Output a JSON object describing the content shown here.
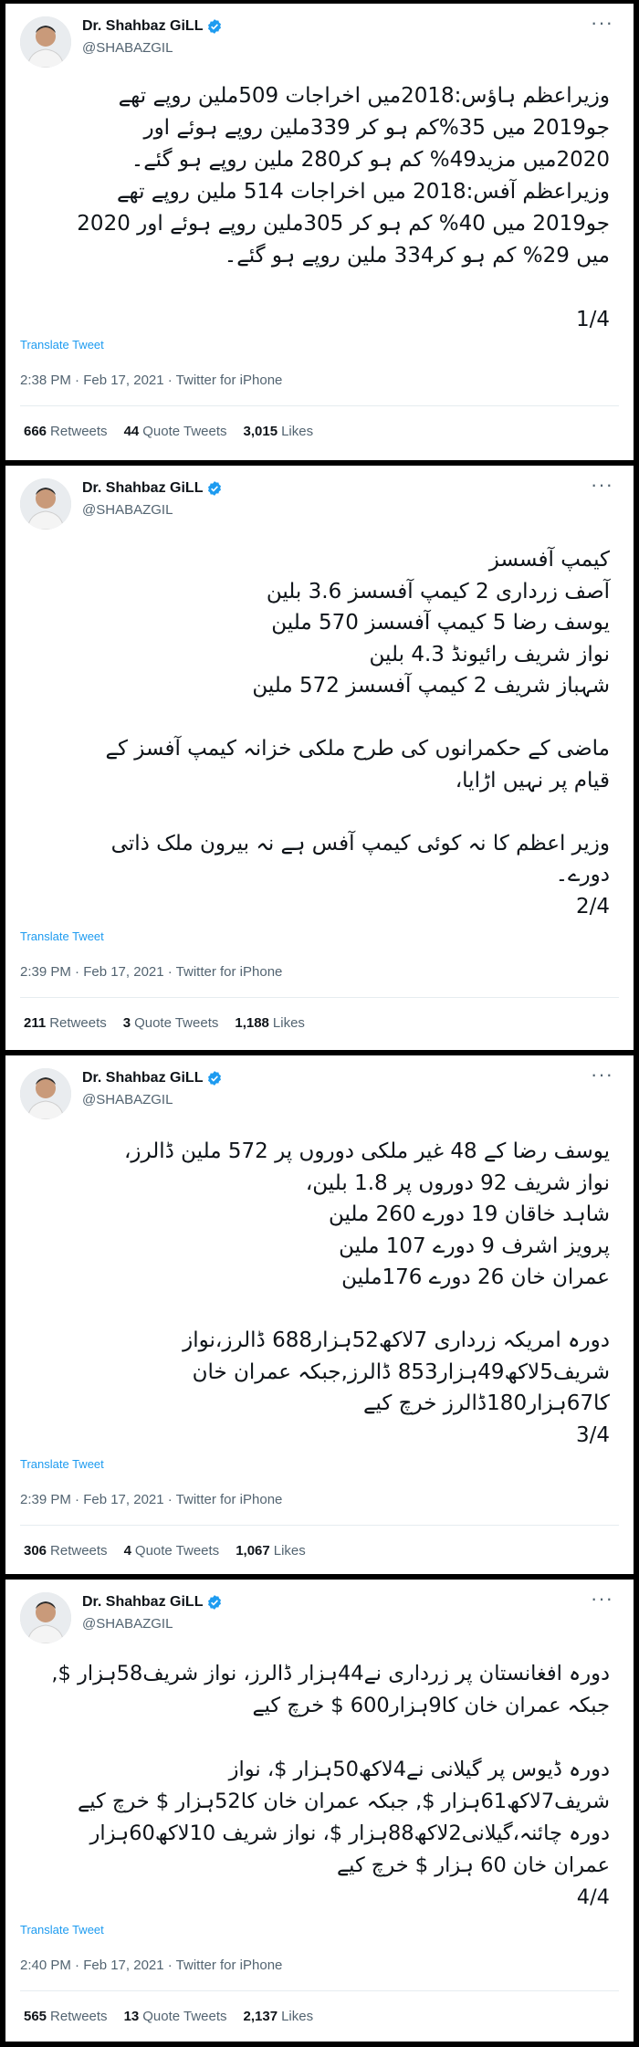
{
  "colors": {
    "link": "#1d9bf0",
    "text": "#0f1419",
    "muted": "#536471",
    "frame": "#000000"
  },
  "tweets": [
    {
      "author": "Dr. Shahbaz GiLL",
      "handle": "@SHABAZGIL",
      "more_icon": "···",
      "text": "وزیراعظم ہاؤس:2018میں اخراجات 509ملین روپے تھے\nجو2019 میں 35%کم ہو کر 339ملین روپے ہوئے اور\n2020میں مزید49% کم ہو کر280 ملین روپے ہو گئے۔\nوزیراعظم آفس:2018 میں اخراجات 514 ملین روپے تھے\nجو2019 میں 40% کم ہو کر 305ملین روپے ہوئے اور 2020\nمیں 29% کم ہو کر334 ملین روپے ہو گئے۔\n\n1/4",
      "translate": "Translate Tweet",
      "timestamp": "2:38 PM · Feb 17, 2021 · Twitter for iPhone",
      "retweets": "666",
      "retweets_label": "Retweets",
      "quotes": "44",
      "quotes_label": "Quote Tweets",
      "likes": "3,015",
      "likes_label": "Likes"
    },
    {
      "author": "Dr. Shahbaz GiLL",
      "handle": "@SHABAZGIL",
      "more_icon": "···",
      "text": "کیمپ آفسسز\nآصف زرداری 2 کیمپ آفسسز 3.6 بلین\nیوسف رضا 5 کیمپ آفسسز 570 ملین\nنواز شریف رائیونڈ 4.3 بلین\nشہباز شریف 2 کیمپ آفسسز 572 ملین\n\nماضی کے حکمرانوں کی طرح ملکی خزانہ کیمپ آفسز کے\nقیام پر نہیں اڑایا،\n\nوزیر اعظم کا نہ کوئی کیمپ آفس ہے نہ بیرون ملک ذاتی\nدورے۔\n2/4",
      "translate": "Translate Tweet",
      "timestamp": "2:39 PM · Feb 17, 2021 · Twitter for iPhone",
      "retweets": "211",
      "retweets_label": "Retweets",
      "quotes": "3",
      "quotes_label": "Quote Tweets",
      "likes": "1,188",
      "likes_label": "Likes"
    },
    {
      "author": "Dr. Shahbaz GiLL",
      "handle": "@SHABAZGIL",
      "more_icon": "···",
      "text": "یوسف رضا کے 48 غیر ملکی دوروں پر 572 ملین ڈالرز،\nنواز شریف 92 دوروں پر 1.8 بلین،\nشاہد خاقان 19 دورے 260 ملین\nپرویز اشرف 9 دورے 107 ملین\nعمران خان 26 دورے 176ملین\n\nدورہ امریکہ زرداری 7لاکھ52ہزار688 ڈالرز،نواز\nشریف5لاکھ49ہزار853 ڈالرز,جبکہ عمران خان\nکا67ہزار180ڈالرز خرچ کیے\n3/4",
      "translate": "Translate Tweet",
      "timestamp": "2:39 PM · Feb 17, 2021 · Twitter for iPhone",
      "retweets": "306",
      "retweets_label": "Retweets",
      "quotes": "4",
      "quotes_label": "Quote Tweets",
      "likes": "1,067",
      "likes_label": "Likes"
    },
    {
      "author": "Dr. Shahbaz GiLL",
      "handle": "@SHABAZGIL",
      "more_icon": "···",
      "text": "دورہ افغانستان پر زرداری نے44ہزار ڈالرز، نواز شریف58ہزار $,\nجبکہ عمران خان کا9ہزار600 $ خرچ کیے\n\nدورہ ڈیوس پر گیلانی نے4لاکھ50ہزار $، نواز\nشریف7لاکھ61ہزار $, جبکہ عمران خان کا52ہزار $ خرچ کیے\nدورہ چائنہ،گیلانی2لاکھ88ہزار $، نواز شریف 10لاکھ60ہزار\nعمران خان 60 ہزار $ خرچ کیے\n4/4",
      "translate": "Translate Tweet",
      "timestamp": "2:40 PM · Feb 17, 2021 · Twitter for iPhone",
      "retweets": "565",
      "retweets_label": "Retweets",
      "quotes": "13",
      "quotes_label": "Quote Tweets",
      "likes": "2,137",
      "likes_label": "Likes"
    }
  ]
}
